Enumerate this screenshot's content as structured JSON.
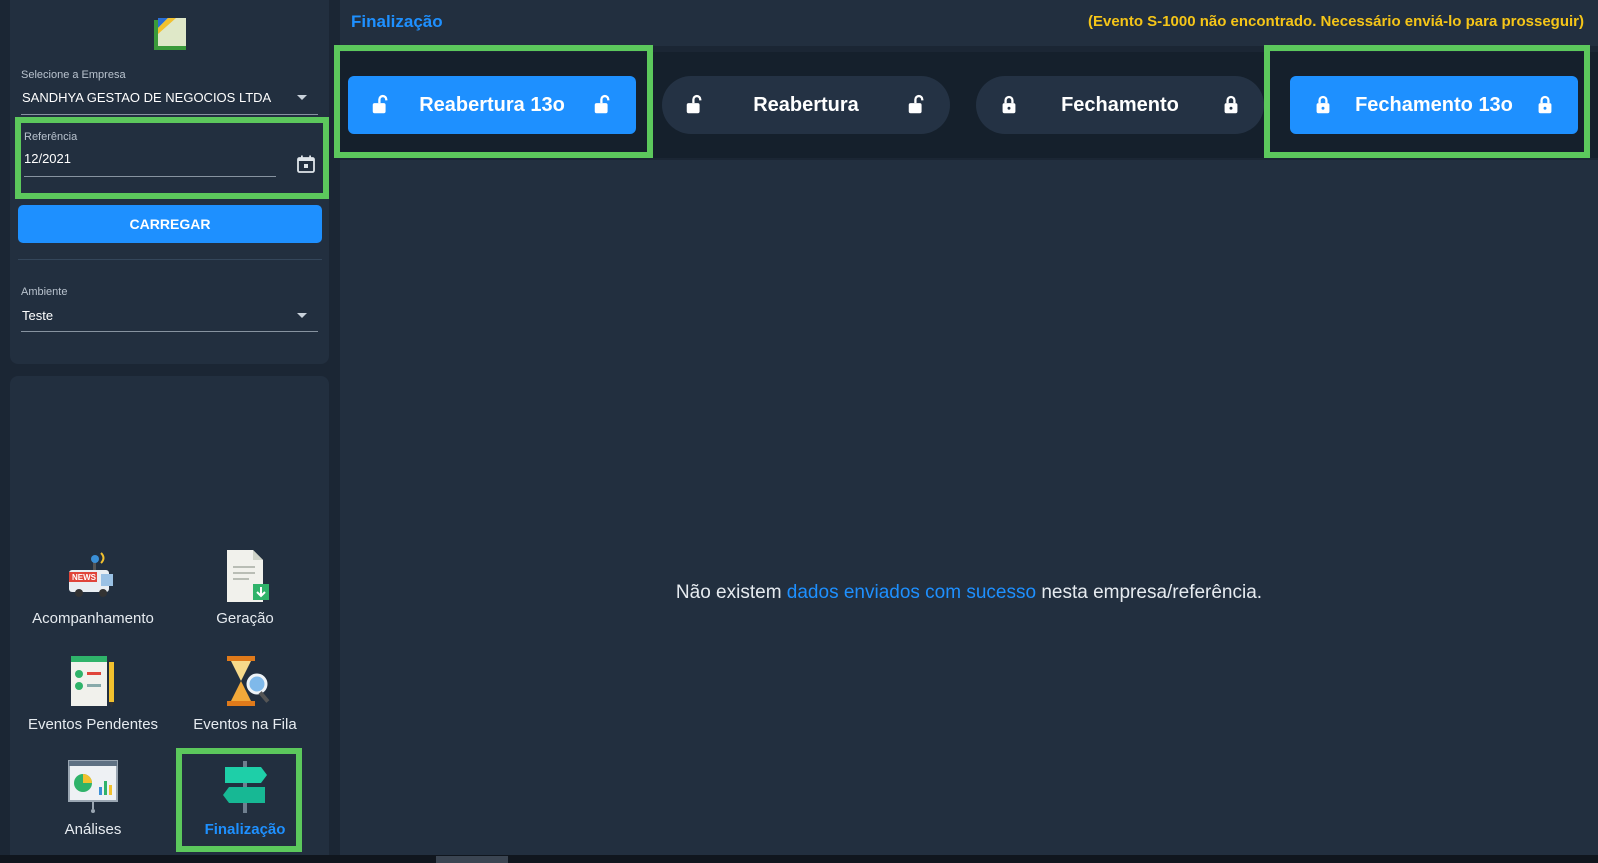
{
  "header": {
    "page_title": "Finalização",
    "warning": "(Evento S-1000 não encontrado. Necessário enviá-lo para prosseguir)"
  },
  "sidebar": {
    "logo_icon": "app-logo-icon",
    "empresa": {
      "label": "Selecione a Empresa",
      "value": "SANDHYA GESTAO DE NEGOCIOS LTDA"
    },
    "referencia": {
      "label": "Referência",
      "value": "12/2021"
    },
    "carregar_label": "CARREGAR",
    "ambiente": {
      "label": "Ambiente",
      "value": "Teste"
    },
    "nav": [
      {
        "label": "Acompanhamento",
        "icon": "news-van-icon"
      },
      {
        "label": "Geração",
        "icon": "document-download-icon"
      },
      {
        "label": "Eventos Pendentes",
        "icon": "checklist-icon"
      },
      {
        "label": "Eventos na Fila",
        "icon": "hourglass-search-icon"
      },
      {
        "label": "Análises",
        "icon": "chart-board-icon"
      },
      {
        "label": "Finalização",
        "icon": "signpost-icon",
        "active": true
      }
    ]
  },
  "actions": [
    {
      "label": "Reabertura 13o",
      "icon": "unlock-icon",
      "primary": true
    },
    {
      "label": "Reabertura",
      "icon": "unlock-icon",
      "primary": false
    },
    {
      "label": "Fechamento",
      "icon": "lock-icon",
      "primary": false
    },
    {
      "label": "Fechamento 13o",
      "icon": "lock-icon",
      "primary": true
    }
  ],
  "empty_state": {
    "before": "Não existem ",
    "highlight": "dados enviados com sucesso",
    "after": " nesta empresa/referência."
  },
  "colors": {
    "accent": "#1e90ff",
    "warning": "#f5c518",
    "highlight_box": "#5cc85c",
    "background": "#1b2634",
    "panel": "#222f3f"
  }
}
